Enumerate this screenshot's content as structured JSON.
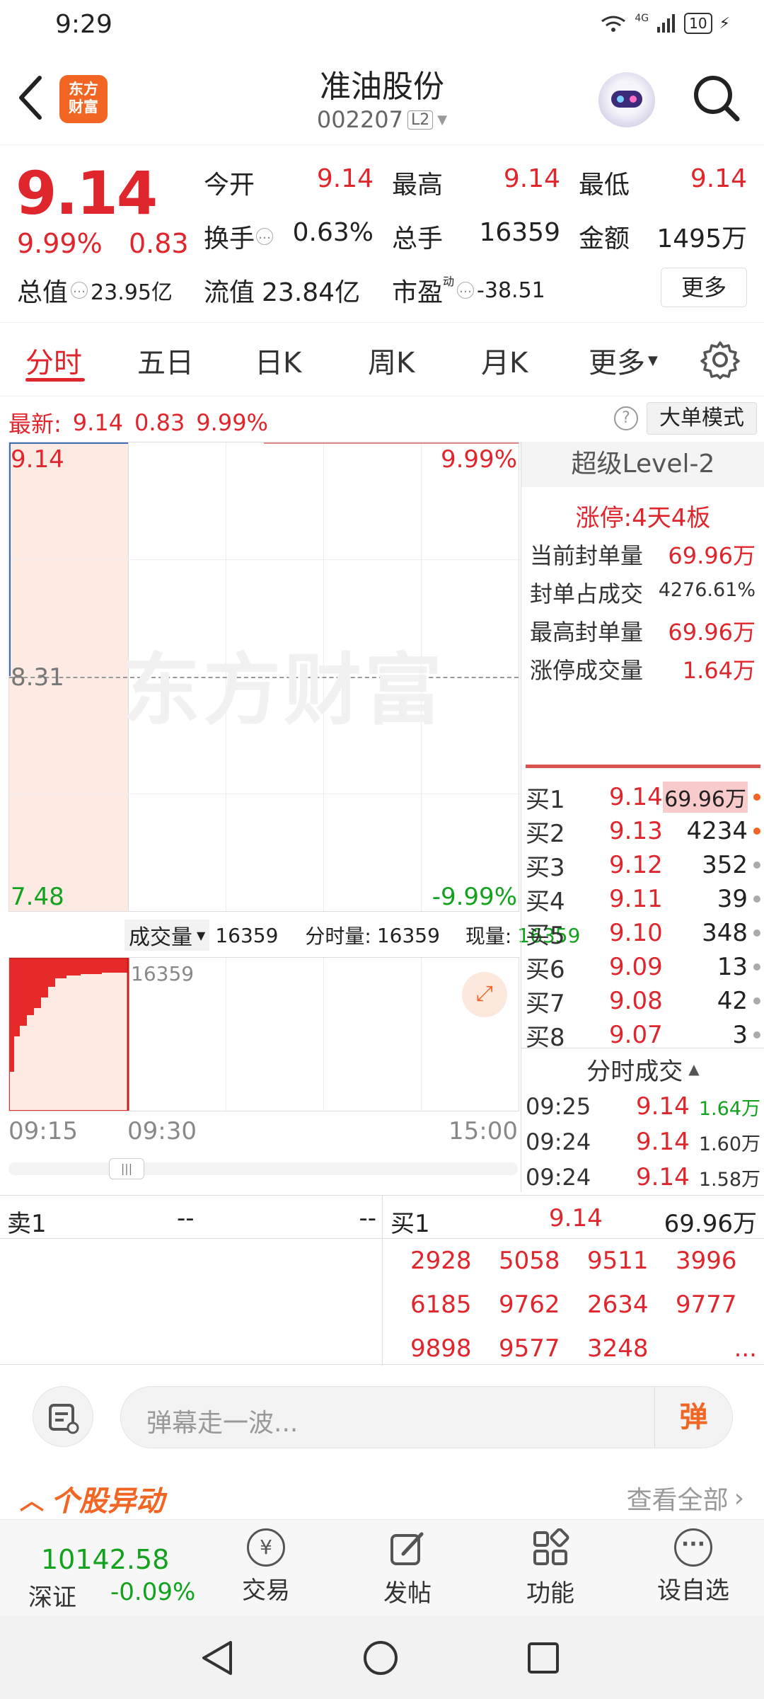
{
  "status": {
    "time": "9:29",
    "net": "4G",
    "battery": "10"
  },
  "header": {
    "logo": "东方\n财富",
    "stock_name": "准油股份",
    "code": "002207",
    "level": "L2"
  },
  "quote": {
    "price": "9.14",
    "pct": "9.99%",
    "chg": "0.83",
    "open_label": "今开",
    "open": "9.14",
    "high_label": "最高",
    "high": "9.14",
    "low_label": "最低",
    "low": "9.14",
    "turnover_label": "换手",
    "turnover": "0.63%",
    "vol_label": "总手",
    "vol": "16359",
    "amount_label": "金额",
    "amount": "1495万",
    "mktcap_label": "总值",
    "mktcap": "23.95亿",
    "float_label": "流值",
    "float": "23.84亿",
    "pe_label": "市盈",
    "pe_sup": "动",
    "pe": "-38.51",
    "more": "更多"
  },
  "tabs": [
    {
      "label": "分时",
      "active": true
    },
    {
      "label": "五日"
    },
    {
      "label": "日K"
    },
    {
      "label": "周K"
    },
    {
      "label": "月K"
    },
    {
      "label": "更多"
    }
  ],
  "latest": {
    "label": "最新:",
    "price": "9.14",
    "chg": "0.83",
    "pct": "9.99%",
    "help": "?",
    "mode_btn": "大单模式"
  },
  "chart": {
    "y_top": "9.14",
    "y_mid": "8.31",
    "y_bot": "7.48",
    "pct_top": "9.99%",
    "pct_bot": "-9.99%",
    "watermark": "东方财富",
    "vol_selector": "成交量",
    "vol_total": "16359",
    "vol_fenshi_label": "分时量:",
    "vol_fenshi": "16359",
    "vol_now_label": "现量:",
    "vol_now": "16359",
    "vol_max": "16359",
    "times": [
      "09:15",
      "09:30",
      "15:00"
    ]
  },
  "level2": {
    "title": "超级Level-2",
    "limit": "涨停:4天4板",
    "stats": [
      {
        "label": "当前封单量",
        "value": "69.96万"
      },
      {
        "label": "封单占成交",
        "value": "4276.61%"
      },
      {
        "label": "最高封单量",
        "value": "69.96万"
      },
      {
        "label": "涨停成交量",
        "value": "1.64万"
      }
    ],
    "bids": [
      {
        "label": "买1",
        "price": "9.14",
        "vol": "69.96万"
      },
      {
        "label": "买2",
        "price": "9.13",
        "vol": "4234"
      },
      {
        "label": "买3",
        "price": "9.12",
        "vol": "352"
      },
      {
        "label": "买4",
        "price": "9.11",
        "vol": "39"
      },
      {
        "label": "买5",
        "price": "9.10",
        "vol": "348"
      },
      {
        "label": "买6",
        "price": "9.09",
        "vol": "13"
      },
      {
        "label": "买7",
        "price": "9.08",
        "vol": "42"
      },
      {
        "label": "买8",
        "price": "9.07",
        "vol": "3"
      }
    ],
    "trades_title": "分时成交",
    "trades": [
      {
        "time": "09:25",
        "price": "9.14",
        "vol": "1.64万"
      },
      {
        "time": "09:24",
        "price": "9.14",
        "vol": "1.60万"
      },
      {
        "time": "09:24",
        "price": "9.14",
        "vol": "1.58万"
      }
    ]
  },
  "queue": {
    "sell_label": "卖1",
    "sell_price": "--",
    "sell_vol": "--",
    "buy_label": "买1",
    "buy_price": "9.14",
    "buy_vol": "69.96万",
    "cells": [
      "2928",
      "5058",
      "9511",
      "3996",
      "6185",
      "9762",
      "2634",
      "9777",
      "9898",
      "9577",
      "3248",
      "..."
    ]
  },
  "danmu": {
    "placeholder": "弹幕走一波...",
    "send": "弹"
  },
  "movement": {
    "title": "个股异动",
    "view_all": "查看全部"
  },
  "bottom": {
    "index_value": "10142.58",
    "index_name": "深证",
    "index_pct": "-0.09%",
    "items": [
      {
        "label": "交易"
      },
      {
        "label": "发帖"
      },
      {
        "label": "功能"
      },
      {
        "label": "设自选"
      }
    ]
  },
  "colors": {
    "up": "#e0262d",
    "down": "#12a21e",
    "accent": "#f26522"
  }
}
